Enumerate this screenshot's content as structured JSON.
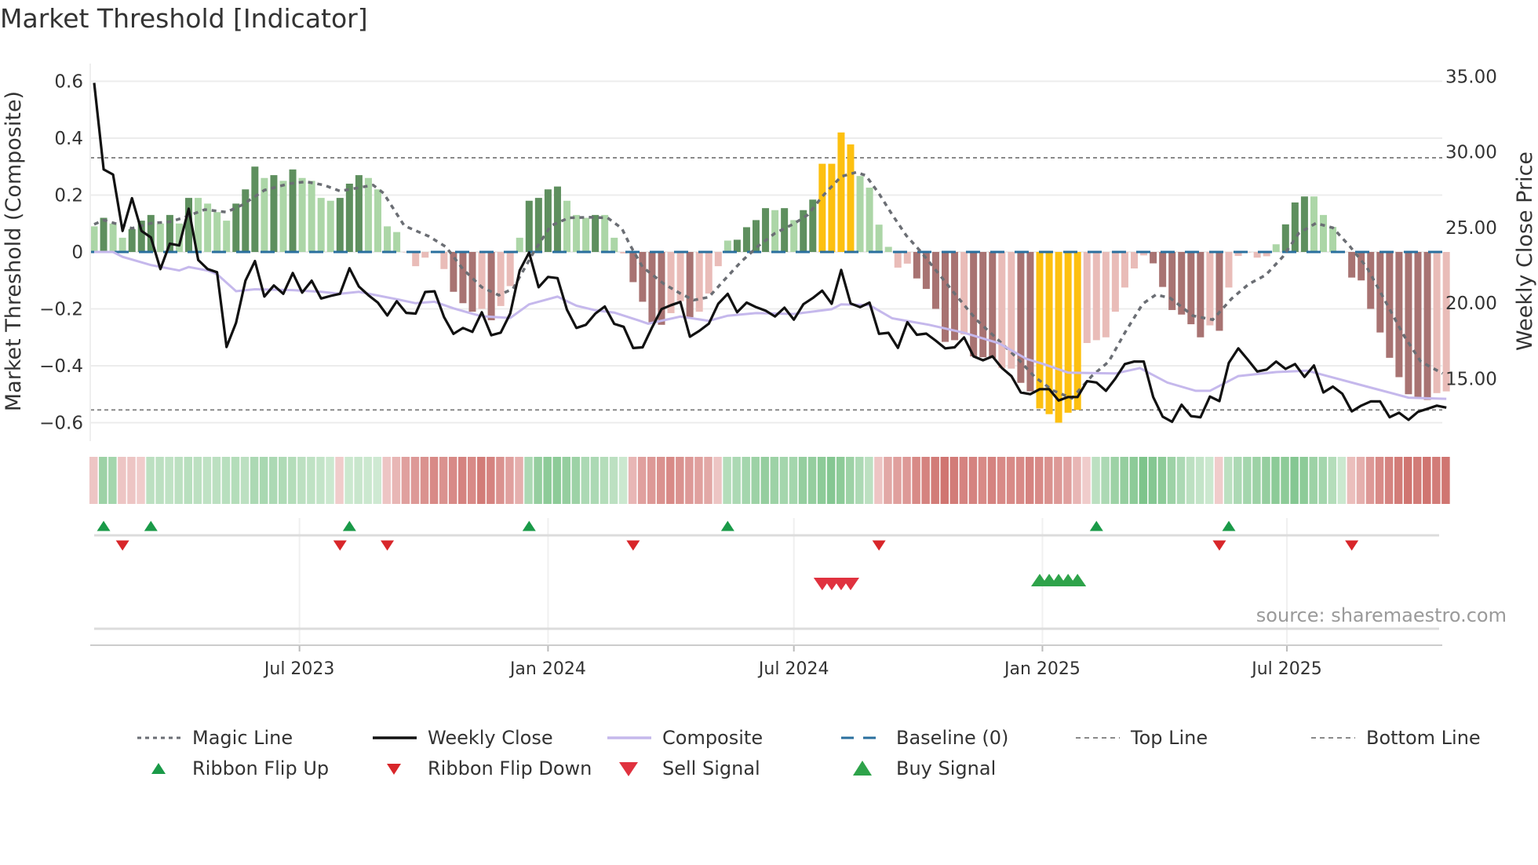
{
  "title": "Market Threshold [Indicator]",
  "source": "source: sharemaestro.com",
  "colors": {
    "dark_green": "#5e8f5e",
    "light_green": "#acd6a7",
    "dark_red": "#a87372",
    "pink": "#e9bcb8",
    "yellow": "#fdc010",
    "weekly_close": "#111111",
    "composite": "#c5b8ec",
    "magic": "#6b6e74",
    "baseline": "#2a6f9e",
    "threshold": "#8a8a8a",
    "flip_up": "#1a9a48",
    "flip_down": "#d8262a",
    "sell": "#e0323f",
    "buy": "#2ea34a"
  },
  "chart_data": {
    "type": "bar",
    "title": "Market Threshold [Indicator]",
    "start_date": "2023-01-30",
    "interval": "weekly",
    "ylabel": "Market Threshold (Composite)",
    "y2label": "Weekly Close Price",
    "ylim": [
      -0.666,
      0.662
    ],
    "y2lim": [
      10.84,
      35.85
    ],
    "yticks": [
      "0.6",
      "0.4",
      "0.2",
      "0",
      "−0.2",
      "−0.4",
      "−0.6"
    ],
    "ytick_values": [
      0.6,
      0.4,
      0.2,
      0,
      -0.2,
      -0.4,
      -0.6
    ],
    "y2ticks": [
      "35.00",
      "30.00",
      "25.00",
      "20.00",
      "15.00"
    ],
    "y2tick_values": [
      35,
      30,
      25,
      20,
      15
    ],
    "xticks": [
      {
        "label": "Jul 2023",
        "date": "2023-07-01"
      },
      {
        "label": "Jan 2024",
        "date": "2024-01-01"
      },
      {
        "label": "Jul 2024",
        "date": "2024-07-01"
      },
      {
        "label": "Jan 2025",
        "date": "2025-01-01"
      },
      {
        "label": "Jul 2025",
        "date": "2025-07-01"
      }
    ],
    "top_line": 0.331,
    "bottom_line": -0.555,
    "baseline": 0,
    "composite_bars": [
      0.09,
      0.12,
      0.1,
      0.05,
      0.08,
      0.11,
      0.13,
      0.1,
      0.13,
      0.1,
      0.19,
      0.19,
      0.17,
      0.14,
      0.11,
      0.17,
      0.22,
      0.3,
      0.26,
      0.27,
      0.25,
      0.29,
      0.26,
      0.25,
      0.19,
      0.18,
      0.19,
      0.24,
      0.27,
      0.26,
      0.22,
      0.09,
      0.07,
      0,
      -0.05,
      -0.02,
      0,
      -0.06,
      -0.14,
      -0.18,
      -0.21,
      -0.2,
      -0.24,
      -0.19,
      -0.12,
      0.05,
      0.18,
      0.19,
      0.22,
      0.23,
      0.18,
      0.13,
      0.12,
      0.13,
      0.13,
      0.05,
      -0.005,
      -0.106,
      -0.175,
      -0.247,
      -0.256,
      -0.215,
      -0.173,
      -0.229,
      -0.21,
      -0.146,
      -0.05,
      0.04,
      0.043,
      0.087,
      0.112,
      0.154,
      0.147,
      0.154,
      0.112,
      0.147,
      0.184,
      0.31,
      0.31,
      0.42,
      0.378,
      0.267,
      0.226,
      0.096,
      0.018,
      -0.055,
      -0.041,
      -0.093,
      -0.13,
      -0.2,
      -0.316,
      -0.31,
      -0.29,
      -0.367,
      -0.37,
      -0.373,
      -0.408,
      -0.41,
      -0.46,
      -0.49,
      -0.55,
      -0.57,
      -0.6,
      -0.565,
      -0.555,
      -0.32,
      -0.31,
      -0.3,
      -0.21,
      -0.125,
      -0.058,
      -0.012,
      -0.04,
      -0.123,
      -0.204,
      -0.22,
      -0.254,
      -0.3,
      -0.258,
      -0.277,
      -0.125,
      -0.014,
      0,
      -0.02,
      -0.015,
      0.027,
      0.097,
      0.174,
      0.195,
      0.195,
      0.13,
      0.088,
      0,
      -0.09,
      -0.1,
      -0.2,
      -0.283,
      -0.372,
      -0.44,
      -0.5,
      -0.515,
      -0.52,
      -0.496,
      -0.49
    ],
    "bar_classes": "LDLLDDDLDLDLLLLDDDLDLDLLLLDDDLLLLPPPPPRRRPRPPLDDDDLLLDLLPRRRRPPRPPPLDDDDLDLDDYYYYLLLLPPRRRRRPRRRPPRRYYYYYPPPPPPPRRRRRRPRPPPPPLDDDLLLPRRRRRRRRRPP",
    "bar_class_legend": {
      "D": "strong positive",
      "L": "weak positive",
      "R": "strong negative",
      "P": "weak negative",
      "Y": "extreme"
    },
    "weekly_close": [
      34.57,
      28.84,
      28.5,
      24.77,
      26.94,
      24.77,
      24.34,
      22.25,
      23.93,
      23.81,
      26.24,
      22.85,
      22.25,
      22.04,
      17.09,
      18.69,
      21.48,
      22.78,
      20.43,
      21.16,
      20.61,
      21.99,
      20.69,
      21.48,
      20.3,
      20.47,
      20.61,
      22.3,
      21.09,
      20.52,
      20.03,
      19.18,
      20.12,
      19.35,
      19.3,
      20.73,
      20.78,
      19.07,
      17.96,
      18.35,
      18.09,
      19.39,
      17.87,
      18.04,
      19.3,
      22.16,
      23.34,
      21.05,
      21.73,
      21.65,
      19.56,
      18.35,
      18.56,
      19.3,
      19.77,
      18.62,
      18.43,
      17.02,
      17.07,
      18.39,
      19.6,
      19.86,
      20.07,
      17.77,
      18.16,
      18.63,
      19.95,
      20.61,
      19.39,
      20.03,
      19.73,
      19.5,
      19.11,
      19.69,
      18.9,
      19.92,
      20.33,
      20.82,
      19.95,
      22.19,
      19.97,
      19.73,
      20.03,
      17.96,
      18.03,
      17.03,
      18.73,
      17.9,
      17.98,
      17.51,
      17.0,
      17.07,
      17.73,
      16.47,
      16.21,
      16.47,
      15.7,
      15.17,
      14.08,
      13.97,
      14.3,
      14.3,
      13.55,
      13.78,
      13.78,
      14.83,
      14.74,
      14.19,
      15.0,
      15.96,
      16.13,
      16.13,
      13.78,
      12.48,
      12.14,
      13.27,
      12.52,
      12.44,
      13.81,
      13.51,
      16.04,
      17.0,
      16.26,
      15.47,
      15.6,
      16.13,
      15.64,
      15.96,
      15.11,
      15.87,
      14.08,
      14.47,
      14.0,
      12.83,
      13.21,
      13.49,
      13.49,
      12.44,
      12.74,
      12.27,
      12.8,
      13.0,
      13.21,
      13.08
    ],
    "composite_line": [
      [
        0,
        0
      ],
      [
        2,
        0
      ],
      [
        3,
        -0.017
      ],
      [
        6,
        -0.046
      ],
      [
        9,
        -0.065
      ],
      [
        10,
        -0.053
      ],
      [
        12,
        -0.065
      ],
      [
        13,
        -0.078
      ],
      [
        15,
        -0.138
      ],
      [
        17,
        -0.131
      ],
      [
        21,
        -0.134
      ],
      [
        24,
        -0.14
      ],
      [
        26,
        -0.147
      ],
      [
        28,
        -0.14
      ],
      [
        32,
        -0.166
      ],
      [
        34,
        -0.18
      ],
      [
        36,
        -0.175
      ],
      [
        38,
        -0.198
      ],
      [
        40,
        -0.217
      ],
      [
        41,
        -0.226
      ],
      [
        44,
        -0.232
      ],
      [
        46,
        -0.184
      ],
      [
        49,
        -0.157
      ],
      [
        51,
        -0.189
      ],
      [
        53,
        -0.205
      ],
      [
        55,
        -0.213
      ],
      [
        57.7,
        -0.242
      ],
      [
        58.6,
        -0.252
      ],
      [
        62,
        -0.227
      ],
      [
        65,
        -0.242
      ],
      [
        67,
        -0.224
      ],
      [
        70,
        -0.215
      ],
      [
        74,
        -0.218
      ],
      [
        78,
        -0.201
      ],
      [
        79,
        -0.184
      ],
      [
        82,
        -0.187
      ],
      [
        84.4,
        -0.233
      ],
      [
        88.3,
        -0.256
      ],
      [
        92,
        -0.284
      ],
      [
        95.7,
        -0.321
      ],
      [
        98.6,
        -0.376
      ],
      [
        100.5,
        -0.395
      ],
      [
        103,
        -0.424
      ],
      [
        108,
        -0.427
      ],
      [
        110.6,
        -0.408
      ],
      [
        113.5,
        -0.459
      ],
      [
        116.5,
        -0.488
      ],
      [
        118,
        -0.488
      ],
      [
        121,
        -0.436
      ],
      [
        125,
        -0.422
      ],
      [
        128.3,
        -0.417
      ],
      [
        131,
        -0.441
      ],
      [
        134.6,
        -0.473
      ],
      [
        139,
        -0.512
      ],
      [
        143,
        -0.516
      ]
    ],
    "magic_line": [
      [
        0,
        0.097
      ],
      [
        1,
        0.112
      ],
      [
        4,
        0.083
      ],
      [
        6,
        0.101
      ],
      [
        8,
        0.106
      ],
      [
        9.4,
        0.12
      ],
      [
        11.7,
        0.149
      ],
      [
        14,
        0.14
      ],
      [
        15.7,
        0.166
      ],
      [
        18,
        0.217
      ],
      [
        20.6,
        0.24
      ],
      [
        22.4,
        0.247
      ],
      [
        24.3,
        0.235
      ],
      [
        26,
        0.214
      ],
      [
        28,
        0.226
      ],
      [
        29.5,
        0.235
      ],
      [
        30.6,
        0.207
      ],
      [
        32.8,
        0.092
      ],
      [
        35.4,
        0.055
      ],
      [
        37.2,
        0.018
      ],
      [
        39,
        -0.06
      ],
      [
        41,
        -0.124
      ],
      [
        42.8,
        -0.152
      ],
      [
        44.3,
        -0.129
      ],
      [
        46.5,
        0
      ],
      [
        48.3,
        0.092
      ],
      [
        50.2,
        0.12
      ],
      [
        52.4,
        0.122
      ],
      [
        54.3,
        0.12
      ],
      [
        55.8,
        0.083
      ],
      [
        56.6,
        0.029
      ],
      [
        58,
        -0.053
      ],
      [
        60.3,
        -0.113
      ],
      [
        62,
        -0.146
      ],
      [
        63.4,
        -0.169
      ],
      [
        65,
        -0.159
      ],
      [
        66.6,
        -0.1
      ],
      [
        68.4,
        -0.035
      ],
      [
        70.2,
        0.02
      ],
      [
        72,
        0.066
      ],
      [
        74,
        0.099
      ],
      [
        75.5,
        0.131
      ],
      [
        77,
        0.195
      ],
      [
        79,
        0.265
      ],
      [
        80.6,
        0.28
      ],
      [
        81.6,
        0.269
      ],
      [
        83,
        0.205
      ],
      [
        84.4,
        0.131
      ],
      [
        85.9,
        0.057
      ],
      [
        87.4,
        0.002
      ],
      [
        89.2,
        -0.072
      ],
      [
        91,
        -0.146
      ],
      [
        93.3,
        -0.238
      ],
      [
        95.7,
        -0.312
      ],
      [
        97.7,
        -0.376
      ],
      [
        99.5,
        -0.44
      ],
      [
        101.4,
        -0.487
      ],
      [
        103.4,
        -0.514
      ],
      [
        105.5,
        -0.436
      ],
      [
        107.3,
        -0.385
      ],
      [
        109,
        -0.284
      ],
      [
        110.9,
        -0.182
      ],
      [
        112.3,
        -0.15
      ],
      [
        113.8,
        -0.162
      ],
      [
        116.2,
        -0.224
      ],
      [
        118.3,
        -0.238
      ],
      [
        120.3,
        -0.164
      ],
      [
        122.1,
        -0.113
      ],
      [
        123.9,
        -0.081
      ],
      [
        125.7,
        -0.017
      ],
      [
        127.4,
        0.066
      ],
      [
        129.2,
        0.101
      ],
      [
        131,
        0.085
      ],
      [
        132.8,
        0.02
      ],
      [
        134.6,
        -0.054
      ],
      [
        136.7,
        -0.182
      ],
      [
        138.5,
        -0.293
      ],
      [
        140.3,
        -0.385
      ],
      [
        142.6,
        -0.427
      ]
    ],
    "ribbon": [
      -0.2,
      0.5,
      0.45,
      -0.2,
      -0.2,
      -0.15,
      0.3,
      0.3,
      0.28,
      0.3,
      0.32,
      0.3,
      0.28,
      0.3,
      0.32,
      0.35,
      0.3,
      0.4,
      0.42,
      0.4,
      0.38,
      0.35,
      0.3,
      0.28,
      0.25,
      0.2,
      -0.15,
      0.2,
      0.22,
      0.2,
      0.18,
      -0.2,
      -0.3,
      -0.45,
      -0.5,
      -0.55,
      -0.6,
      -0.55,
      -0.6,
      -0.65,
      -0.6,
      -0.7,
      -0.65,
      -0.55,
      -0.45,
      -0.35,
      0.4,
      0.55,
      0.6,
      0.6,
      0.55,
      0.5,
      0.4,
      0.4,
      0.35,
      0.3,
      0.2,
      -0.3,
      -0.45,
      -0.5,
      -0.55,
      -0.6,
      -0.55,
      -0.5,
      -0.45,
      -0.4,
      -0.2,
      0.35,
      0.4,
      0.45,
      0.5,
      0.55,
      0.5,
      0.45,
      0.45,
      0.55,
      0.55,
      0.6,
      0.65,
      0.6,
      0.5,
      0.4,
      0.3,
      -0.2,
      -0.4,
      -0.45,
      -0.5,
      -0.6,
      -0.65,
      -0.7,
      -0.75,
      -0.7,
      -0.65,
      -0.65,
      -0.6,
      -0.65,
      -0.6,
      -0.6,
      -0.6,
      -0.65,
      -0.6,
      -0.55,
      -0.5,
      -0.45,
      -0.3,
      -0.15,
      0.3,
      0.4,
      0.5,
      0.55,
      0.6,
      0.7,
      0.65,
      0.6,
      0.5,
      0.4,
      0.3,
      0.25,
      0.2,
      -0.15,
      0.3,
      0.4,
      0.45,
      0.5,
      0.55,
      0.6,
      0.6,
      0.65,
      0.6,
      0.5,
      0.45,
      0.35,
      0.2,
      -0.25,
      -0.35,
      -0.5,
      -0.6,
      -0.65,
      -0.7,
      -0.75,
      -0.7,
      -0.75,
      -0.7,
      -0.75
    ],
    "ribbon_flip_up_weeks": [
      1,
      6,
      27,
      46,
      67,
      106,
      120
    ],
    "ribbon_flip_down_weeks": [
      3,
      26,
      31,
      57,
      83,
      119,
      133
    ],
    "sell_signal_weeks": [
      77,
      78,
      79,
      80
    ],
    "buy_signal_weeks": [
      100,
      101,
      102,
      103,
      104
    ]
  },
  "legend": [
    {
      "label": "Magic Line",
      "symbol": "dotted-line"
    },
    {
      "label": "Weekly Close",
      "symbol": "solid-black-line"
    },
    {
      "label": "Composite",
      "symbol": "lavender-line"
    },
    {
      "label": "Baseline (0)",
      "symbol": "dashed-blue-line"
    },
    {
      "label": "Top Line",
      "symbol": "dashed-gray-line"
    },
    {
      "label": "Bottom Line",
      "symbol": "dashed-gray-line"
    },
    {
      "label": "Ribbon Flip Up",
      "symbol": "triangle-up-small"
    },
    {
      "label": "Ribbon Flip Down",
      "symbol": "triangle-down-small"
    },
    {
      "label": "Sell Signal",
      "symbol": "triangle-down-large"
    },
    {
      "label": "Buy Signal",
      "symbol": "triangle-up-large"
    }
  ]
}
